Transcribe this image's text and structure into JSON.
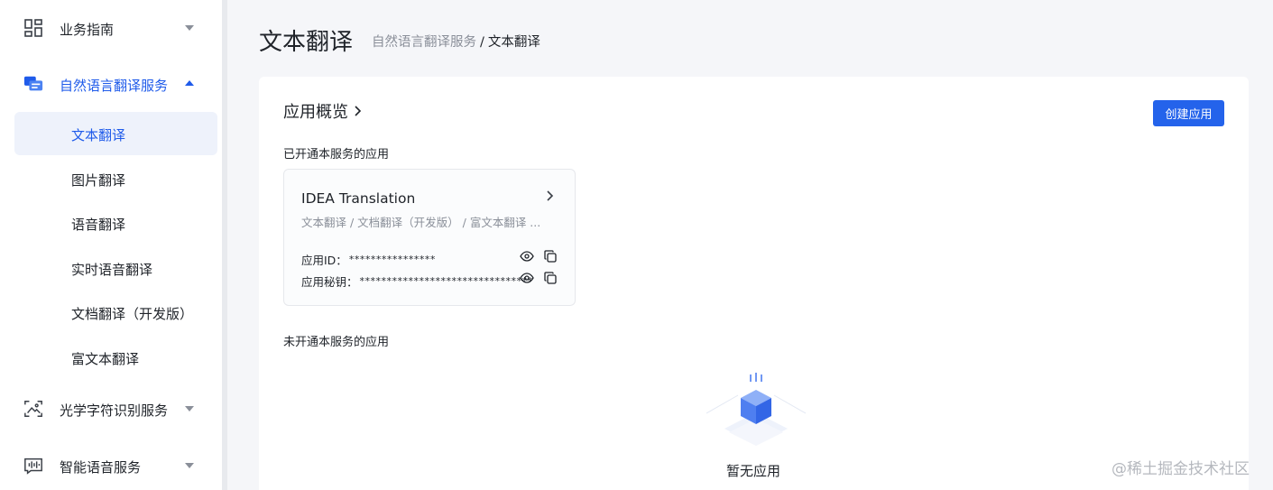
{
  "sidebar": {
    "groups": [
      {
        "label": "业务指南"
      },
      {
        "label": "自然语言翻译服务"
      },
      {
        "label": "光学字符识别服务"
      },
      {
        "label": "智能语音服务"
      }
    ],
    "sub_items": [
      {
        "label": "文本翻译"
      },
      {
        "label": "图片翻译"
      },
      {
        "label": "语音翻译"
      },
      {
        "label": "实时语音翻译"
      },
      {
        "label": "文档翻译（开发版）"
      },
      {
        "label": "富文本翻译"
      }
    ]
  },
  "header": {
    "title": "文本翻译",
    "breadcrumb": {
      "parent": "自然语言翻译服务",
      "separator": "/",
      "current": "文本翻译"
    }
  },
  "overview": {
    "title": "应用概览",
    "create_button": "创建应用",
    "enabled_label": "已开通本服务的应用",
    "disabled_label": "未开通本服务的应用",
    "app": {
      "name": "IDEA Translation",
      "services": "文本翻译 / 文档翻译（开发版） / 富文本翻译 ...",
      "id_label": "应用ID：",
      "id_mask": "****************",
      "secret_label": "应用秘钥：",
      "secret_mask": "********************************"
    },
    "empty_text": "暂无应用"
  },
  "watermark": "@稀土掘金技术社区",
  "colors": {
    "accent": "#1f5bea",
    "button": "#2463eb"
  }
}
